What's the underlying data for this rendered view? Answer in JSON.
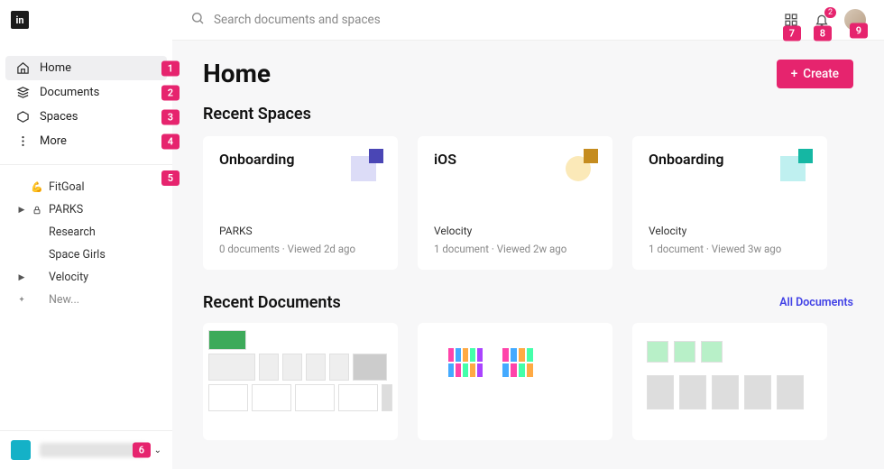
{
  "search": {
    "placeholder": "Search documents and spaces"
  },
  "header": {
    "notification_count": "2",
    "create_label": "Create",
    "apps_badge": "7",
    "noti_badge": "8",
    "avatar_badge": "9"
  },
  "sidebar": {
    "nav": [
      {
        "label": "Home",
        "badge": "1"
      },
      {
        "label": "Documents",
        "badge": "2"
      },
      {
        "label": "Spaces",
        "badge": "3"
      },
      {
        "label": "More",
        "badge": "4"
      }
    ],
    "fitgoal_badge": "5",
    "spaces": [
      {
        "emoji": "💪",
        "label": "FitGoal"
      },
      {
        "lock": true,
        "caret": true,
        "label": "PARKS"
      },
      {
        "label": "Research"
      },
      {
        "label": "Space Girls"
      },
      {
        "caret": true,
        "label": "Velocity"
      }
    ],
    "new_label": "New...",
    "footer_badge": "6"
  },
  "page": {
    "title": "Home",
    "recent_spaces_title": "Recent Spaces",
    "recent_docs_title": "Recent Documents",
    "all_docs_link": "All Documents",
    "spaces": [
      {
        "title": "Onboarding",
        "subtitle": "PARKS",
        "meta": "0 documents  ·  Viewed 2d ago"
      },
      {
        "title": "iOS",
        "subtitle": "Velocity",
        "meta": "1 document  ·  Viewed 2w ago"
      },
      {
        "title": "Onboarding",
        "subtitle": "Velocity",
        "meta": "1 document  ·  Viewed 3w ago"
      }
    ]
  }
}
